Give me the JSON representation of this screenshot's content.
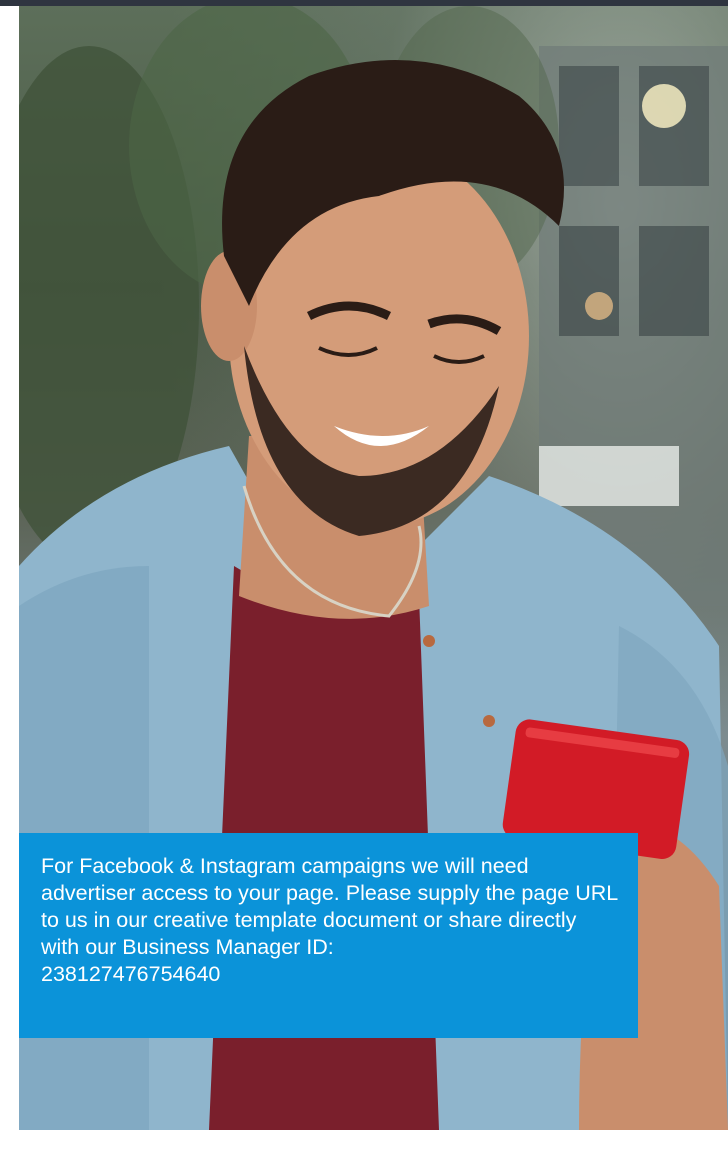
{
  "notice": {
    "text": "For Facebook & Instagram campaigns we will need advertiser access to your page. Please supply the page URL to us in our creative template document or share directly with our Business Manager ID:",
    "business_manager_id": "238127476754640"
  },
  "colors": {
    "notice_background": "#0b93d9",
    "notice_text": "#ffffff",
    "top_bar": "#2f3540"
  },
  "photo": {
    "icon": "photo-of-man-smiling-at-phone"
  }
}
